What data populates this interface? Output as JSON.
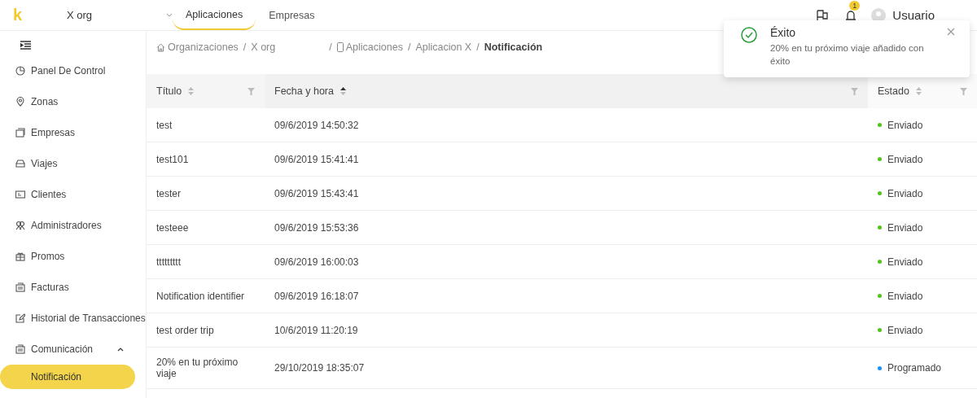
{
  "header": {
    "logo": "k",
    "org": "X org",
    "tabs": [
      {
        "label": "Aplicaciones",
        "selected": true
      },
      {
        "label": "Empresas",
        "selected": false
      }
    ],
    "notification_count": "1",
    "user": "Usuario"
  },
  "sidebar": {
    "items": [
      {
        "label": "Panel De Control",
        "selected": false
      },
      {
        "label": "Zonas",
        "selected": false
      },
      {
        "label": "Empresas",
        "selected": false
      },
      {
        "label": "Viajes",
        "selected": false
      },
      {
        "label": "Clientes",
        "selected": false
      },
      {
        "label": "Administradores",
        "selected": false
      },
      {
        "label": "Promos",
        "selected": false
      },
      {
        "label": "Facturas",
        "selected": false
      },
      {
        "label": "Historial de Transacciones",
        "selected": false
      },
      {
        "label": "Comunicación",
        "selected": false,
        "expanded": true,
        "children": [
          {
            "label": "Notificación",
            "selected": true
          }
        ]
      }
    ]
  },
  "breadcrumb": [
    {
      "label": "Organizaciones",
      "current": false,
      "separator": "/"
    },
    {
      "label": "X org",
      "current": false,
      "separator": "/"
    },
    {
      "label": "Aplicaciones",
      "current": false,
      "separator": "/"
    },
    {
      "label": "Aplicacion X",
      "current": false,
      "separator": "/"
    },
    {
      "label": "Notificación",
      "current": true
    }
  ],
  "table": {
    "columns": [
      {
        "label": "Título",
        "sorted": false
      },
      {
        "label": "Fecha y hora",
        "sorted": true
      },
      {
        "label": "Estado",
        "sorted": false
      }
    ],
    "rows": [
      {
        "title": "test",
        "date": "09/6/2019 14:50:32",
        "status": "Enviado",
        "color": "#52c41a"
      },
      {
        "title": "test101",
        "date": "09/6/2019 15:41:41",
        "status": "Enviado",
        "color": "#52c41a"
      },
      {
        "title": "tester",
        "date": "09/6/2019 15:43:41",
        "status": "Enviado",
        "color": "#52c41a"
      },
      {
        "title": "testeee",
        "date": "09/6/2019 15:53:36",
        "status": "Enviado",
        "color": "#52c41a"
      },
      {
        "title": "ttttttttt",
        "date": "09/6/2019 16:00:03",
        "status": "Enviado",
        "color": "#52c41a"
      },
      {
        "title": "Notification identifier",
        "date": "09/6/2019 16:18:07",
        "status": "Enviado",
        "color": "#52c41a"
      },
      {
        "title": "test order trip",
        "date": "10/6/2019 11:20:19",
        "status": "Enviado",
        "color": "#52c41a"
      },
      {
        "title": "20% en tu próximo viaje",
        "date": "29/10/2019 18:35:07",
        "status": "Programado",
        "color": "#1890ff"
      }
    ]
  },
  "toast": {
    "title": "Éxito",
    "message": "20% en tu próximo viaje añadido con éxito"
  }
}
